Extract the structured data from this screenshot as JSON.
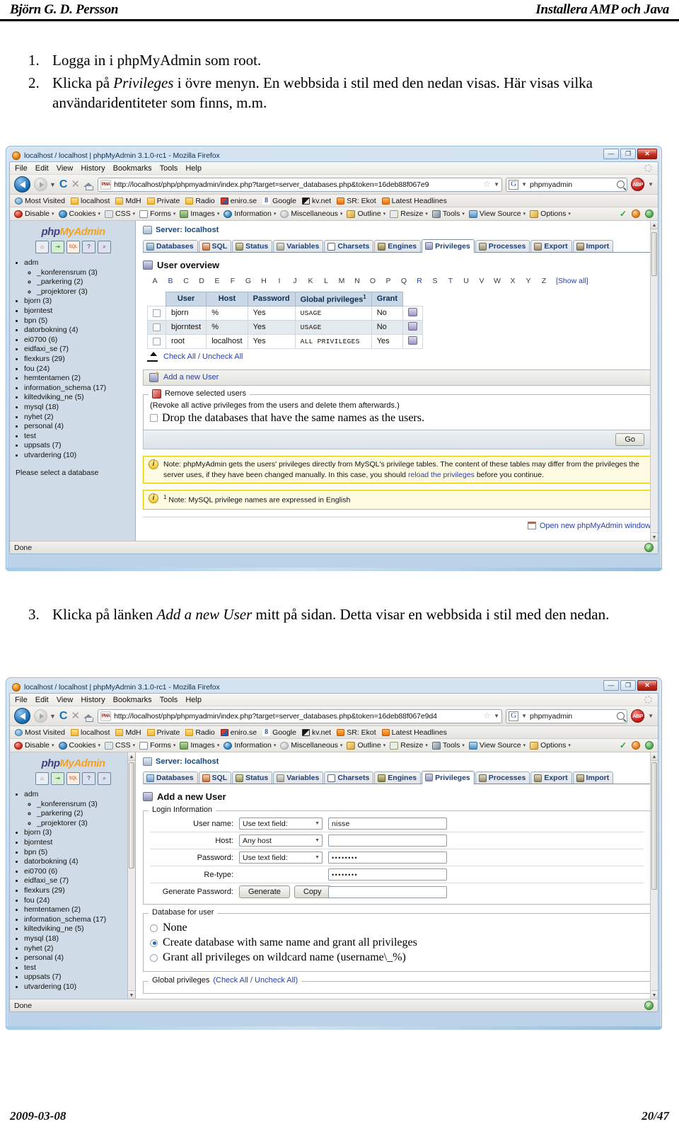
{
  "page": {
    "header_left": "Björn G. D. Persson",
    "header_right": "Installera AMP och Java",
    "footer_left": "2009-03-08",
    "footer_right": "20/47"
  },
  "steps_top": [
    {
      "num": "1.",
      "text_before": "Logga in i phpMyAdmin som root.",
      "italic": "",
      "text_after": ""
    },
    {
      "num": "2.",
      "text_before": "Klicka på ",
      "italic": "Privileges",
      "text_after": " i övre menyn. En webbsida i stil med den nedan visas. Här visas vilka användaridentiteter som finns, m.m."
    }
  ],
  "steps_mid": [
    {
      "num": "3.",
      "text_before": "Klicka på länken ",
      "italic": "Add a new User",
      "text_after": " mitt på sidan. Detta visar en webbsida i stil med den nedan."
    }
  ],
  "browser": {
    "title": "localhost / localhost | phpMyAdmin 3.1.0-rc1 - Mozilla Firefox",
    "window_buttons": {
      "minimize": "—",
      "maximize": "❐",
      "close": "✕"
    },
    "menu": [
      "File",
      "Edit",
      "View",
      "History",
      "Bookmarks",
      "Tools",
      "Help"
    ],
    "nav": {
      "back_icon": "back-arrow-icon",
      "forward_icon": "forward-arrow-icon",
      "reload_icon": "C",
      "stop_icon": "✕",
      "home_icon": "home-icon",
      "favicon_label": "PMA",
      "url_1": "http://localhost/php/phpmyadmin/index.php?target=server_databases.php&token=16deb88f067e9",
      "url_2": "http://localhost/php/phpmyadmin/index.php?target=server_databases.php&token=16deb88f067e9d4",
      "star_icon": "☆",
      "search_engine": "G",
      "search_value": "phpmyadmin",
      "adblock_label": "ABP"
    },
    "bookmarks": [
      {
        "label": "Most Visited",
        "icon": "globe-icon"
      },
      {
        "label": "localhost",
        "icon": "folder-icon"
      },
      {
        "label": "MdH",
        "icon": "folder-icon"
      },
      {
        "label": "Private",
        "icon": "folder-icon"
      },
      {
        "label": "Radio",
        "icon": "folder-icon"
      },
      {
        "label": "eniro.se",
        "icon": "eniro-icon"
      },
      {
        "label": "Google",
        "icon": "google-icon"
      },
      {
        "label": "kv.net",
        "icon": "kvnet-icon"
      },
      {
        "label": "SR: Ekot",
        "icon": "rss-icon"
      },
      {
        "label": "Latest Headlines",
        "icon": "rss-icon"
      }
    ],
    "devtoolbar": [
      {
        "label": "Disable",
        "icon": "disable-icon"
      },
      {
        "label": "Cookies",
        "icon": "cookies-icon"
      },
      {
        "label": "CSS",
        "icon": "css-icon"
      },
      {
        "label": "Forms",
        "icon": "forms-icon"
      },
      {
        "label": "Images",
        "icon": "images-icon"
      },
      {
        "label": "Information",
        "icon": "information-icon"
      },
      {
        "label": "Miscellaneous",
        "icon": "miscellaneous-icon"
      },
      {
        "label": "Outline",
        "icon": "outline-icon"
      },
      {
        "label": "Resize",
        "icon": "resize-icon"
      },
      {
        "label": "Tools",
        "icon": "tools-icon"
      },
      {
        "label": "View Source",
        "icon": "view-source-icon"
      },
      {
        "label": "Options",
        "icon": "options-icon"
      }
    ],
    "status": {
      "text": "Done",
      "indicator": "✓"
    }
  },
  "pma": {
    "logo_part1": "php",
    "logo_part2": "MyAdmin",
    "quick_icons": [
      "home-icon",
      "exit-icon",
      "sql-icon",
      "help-icon",
      "search-icon"
    ],
    "databases": [
      {
        "name": "adm",
        "count": "",
        "children": [
          {
            "name": "_konferensrum (3)"
          },
          {
            "name": "_parkering (2)"
          },
          {
            "name": "_projektorer (3)"
          }
        ]
      },
      {
        "name": "bjorn (3)",
        "children": []
      },
      {
        "name": "bjorntest",
        "children": []
      },
      {
        "name": "bpn (5)",
        "children": []
      },
      {
        "name": "datorbokning (4)",
        "children": []
      },
      {
        "name": "ei0700 (6)",
        "children": []
      },
      {
        "name": "eidfaxi_se (7)",
        "children": []
      },
      {
        "name": "flexkurs (29)",
        "children": []
      },
      {
        "name": "fou (24)",
        "children": []
      },
      {
        "name": "hemtentamen (2)",
        "children": []
      },
      {
        "name": "information_schema (17)",
        "children": []
      },
      {
        "name": "kiltedviking_ne (5)",
        "children": []
      },
      {
        "name": "mysql (18)",
        "children": []
      },
      {
        "name": "nyhet (2)",
        "children": []
      },
      {
        "name": "personal (4)",
        "children": []
      },
      {
        "name": "test",
        "children": []
      },
      {
        "name": "uppsats (7)",
        "children": []
      },
      {
        "name": "utvardering (10)",
        "children": []
      }
    ],
    "select_db_hint": "Please select a database",
    "server_label": "Server: localhost",
    "tabs": [
      {
        "label": "Databases",
        "icon": "databases-icon",
        "active": false
      },
      {
        "label": "SQL",
        "icon": "sql-icon",
        "active": false
      },
      {
        "label": "Status",
        "icon": "status-icon",
        "active": false
      },
      {
        "label": "Variables",
        "icon": "variables-icon",
        "active": false
      },
      {
        "label": "Charsets",
        "icon": "charsets-icon",
        "active": false
      },
      {
        "label": "Engines",
        "icon": "engines-icon",
        "active": false
      },
      {
        "label": "Privileges",
        "icon": "privileges-icon",
        "active": true
      },
      {
        "label": "Processes",
        "icon": "processes-icon",
        "active": false
      },
      {
        "label": "Export",
        "icon": "export-icon",
        "active": false
      },
      {
        "label": "Import",
        "icon": "import-icon",
        "active": false
      }
    ],
    "overview": {
      "title": "User overview",
      "alphabet": [
        "A",
        "B",
        "C",
        "D",
        "E",
        "F",
        "G",
        "H",
        "I",
        "J",
        "K",
        "L",
        "M",
        "N",
        "O",
        "P",
        "Q",
        "R",
        "S",
        "T",
        "U",
        "V",
        "W",
        "X",
        "Y",
        "Z"
      ],
      "alphabet_links": [
        "B",
        "R",
        "T"
      ],
      "show_all": "[Show all]",
      "columns": [
        "User",
        "Host",
        "Password",
        "Global privileges",
        "Grant"
      ],
      "global_priv_footnote": "1",
      "rows": [
        {
          "user": "bjorn",
          "host": "%",
          "password": "Yes",
          "privileges": "USAGE",
          "grant": "No"
        },
        {
          "user": "bjorntest",
          "host": "%",
          "password": "Yes",
          "privileges": "USAGE",
          "grant": "No"
        },
        {
          "user": "root",
          "host": "localhost",
          "password": "Yes",
          "privileges": "ALL PRIVILEGES",
          "grant": "Yes"
        }
      ],
      "check_all": "Check All / Uncheck All",
      "add_new_user": "Add a new User",
      "remove_legend": "Remove selected users",
      "remove_note": "(Revoke all active privileges from the users and delete them afterwards.)",
      "drop_db_label": "Drop the databases that have the same names as the users.",
      "go_button": "Go",
      "note_1_a": "Note: phpMyAdmin gets the users' privileges directly from MySQL's privilege tables. The content of these tables may differ from the privileges the server uses, if they have been changed manually. In this case, you should ",
      "note_1_link": "reload the privileges",
      "note_1_b": " before you continue.",
      "note_2_sup": "1",
      "note_2": " Note: MySQL privilege names are expressed in English",
      "open_new_window": "Open new phpMyAdmin window"
    },
    "adduser": {
      "title": "Add a new User",
      "login_legend": "Login Information",
      "rows": [
        {
          "label": "User name:",
          "select": "Use text field:",
          "value": "nisse",
          "type": "text"
        },
        {
          "label": "Host:",
          "select": "Any host",
          "value": "",
          "type": "text"
        },
        {
          "label": "Password:",
          "select": "Use text field:",
          "value": "••••••••",
          "type": "password"
        },
        {
          "label": "Re-type:",
          "select": "",
          "value": "••••••••",
          "type": "password"
        }
      ],
      "generate_label": "Generate Password:",
      "generate_button": "Generate",
      "copy_button": "Copy",
      "generate_value": "",
      "db_legend": "Database for user",
      "db_options": [
        {
          "label": "None",
          "selected": false
        },
        {
          "label": "Create database with same name and grant all privileges",
          "selected": true
        },
        {
          "label": "Grant all privileges on wildcard name (username\\_%)",
          "selected": false
        }
      ],
      "global_legend": "Global privileges",
      "global_check_all": "Check All",
      "global_sep": " / ",
      "global_uncheck_all": "Uncheck All"
    }
  }
}
